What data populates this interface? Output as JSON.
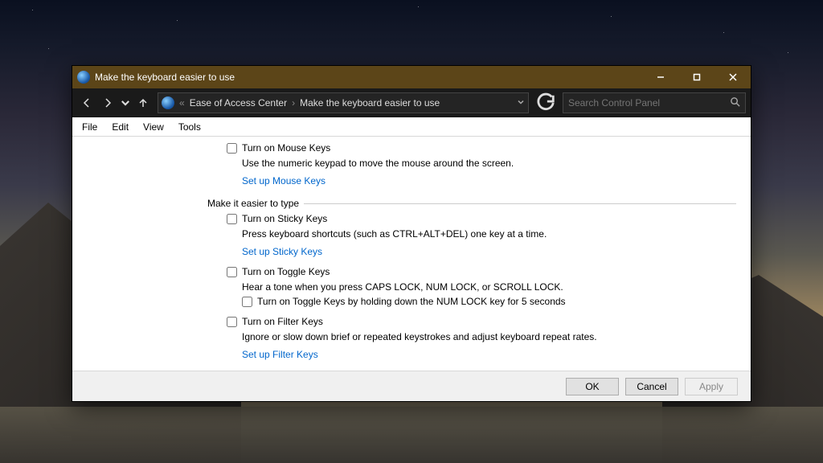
{
  "window": {
    "title": "Make the keyboard easier to use"
  },
  "breadcrumb": {
    "root_glyph": "«",
    "items": [
      "Ease of Access Center",
      "Make the keyboard easier to use"
    ]
  },
  "search": {
    "placeholder": "Search Control Panel"
  },
  "menu": [
    "File",
    "Edit",
    "View",
    "Tools"
  ],
  "mousekeys": {
    "checkbox_label": "Turn on Mouse Keys",
    "description": "Use the numeric keypad to move the mouse around the screen.",
    "link": "Set up Mouse Keys"
  },
  "section_type": "Make it easier to type",
  "stickykeys": {
    "checkbox_label": "Turn on Sticky Keys",
    "description": "Press keyboard shortcuts (such as CTRL+ALT+DEL) one key at a time.",
    "link": "Set up Sticky Keys"
  },
  "togglekeys": {
    "checkbox_label": "Turn on Toggle Keys",
    "description": "Hear a tone when you press CAPS LOCK, NUM LOCK, or SCROLL LOCK.",
    "sub_checkbox_label": "Turn on Toggle Keys by holding down the NUM LOCK key for 5 seconds"
  },
  "filterkeys": {
    "checkbox_label": "Turn on Filter Keys",
    "description": "Ignore or slow down brief or repeated keystrokes and adjust keyboard repeat rates.",
    "link": "Set up Filter Keys"
  },
  "footer": {
    "ok": "OK",
    "cancel": "Cancel",
    "apply": "Apply"
  }
}
